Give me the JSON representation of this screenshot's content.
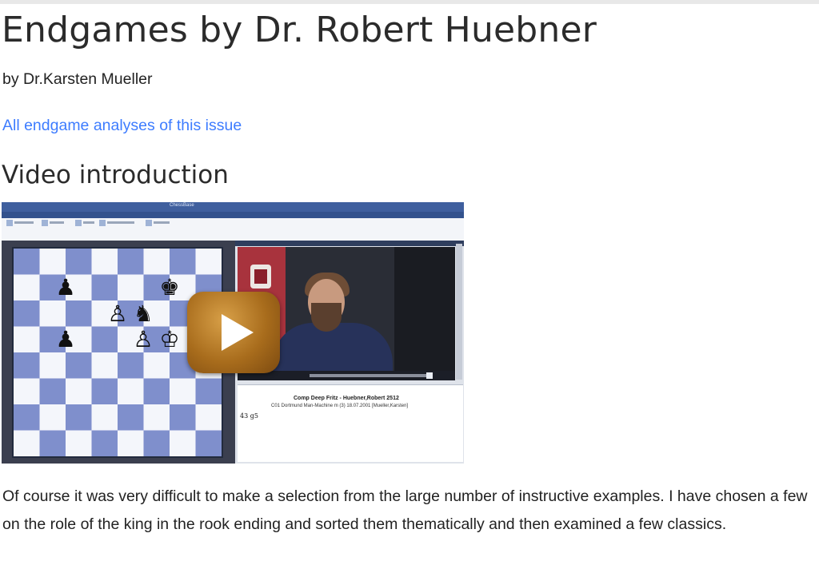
{
  "page": {
    "title": "Endgames by Dr. Robert Huebner",
    "byline": "by Dr.Karsten Mueller",
    "link_text": "All endgame analyses of this issue",
    "section_heading": "Video introduction",
    "paragraph": "Of course it was very difficult to make a selection from the large number of instructive examples. I have chosen a few on the role of the king in the rook ending and sorted them thematically and then examined a few classics."
  },
  "video": {
    "notation_line1": "Comp Deep Fritz - Huebner,Robert 2512",
    "notation_line2": "C01 Dortmund Man-Machine m (3) 18.07.2001 [Mueller,Karsten]",
    "notation_move": "43 g5",
    "play_icon": "play-icon",
    "colors": {
      "play_button": "#a86c1c",
      "board_dark": "#7f8fcc",
      "board_light": "#f4f6fb"
    }
  }
}
